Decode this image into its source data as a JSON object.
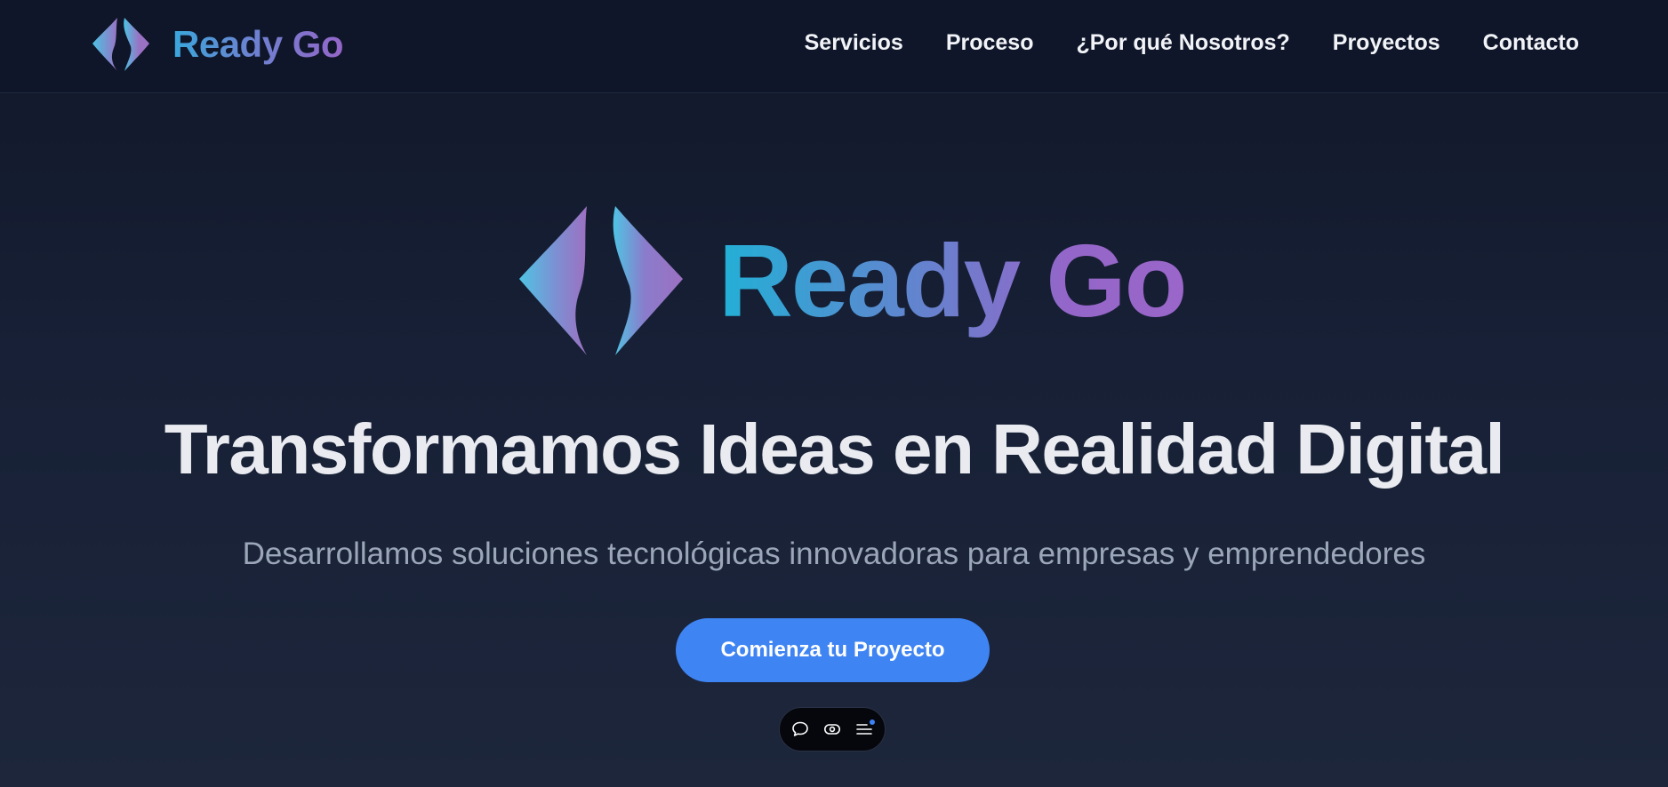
{
  "brand": {
    "name": "Ready Go",
    "colors": {
      "cyan": "#3ec6e0",
      "blue": "#5f86cf",
      "purple": "#9466c9"
    }
  },
  "nav": {
    "links": [
      {
        "label": "Servicios"
      },
      {
        "label": "Proceso"
      },
      {
        "label": "¿Por qué Nosotros?"
      },
      {
        "label": "Proyectos"
      },
      {
        "label": "Contacto"
      }
    ]
  },
  "hero": {
    "logo_text": "Ready Go",
    "title": "Transformamos Ideas en Realidad Digital",
    "subtitle": "Desarrollamos soluciones tecnológicas innovadoras para empresas y emprendedores",
    "cta_label": "Comienza tu Proyecto",
    "cta_color": "#3e84f3"
  },
  "toolbar": {
    "icons": [
      "chat-bubble-icon",
      "eye-icon",
      "menu-list-icon"
    ],
    "notification_dot_color": "#3b82f6"
  },
  "colors": {
    "background_top": "#111729",
    "background_bottom": "#1d263b",
    "nav_background": "#0f1629",
    "text_primary": "#e9ebf0",
    "text_secondary": "#9ba6b8"
  }
}
